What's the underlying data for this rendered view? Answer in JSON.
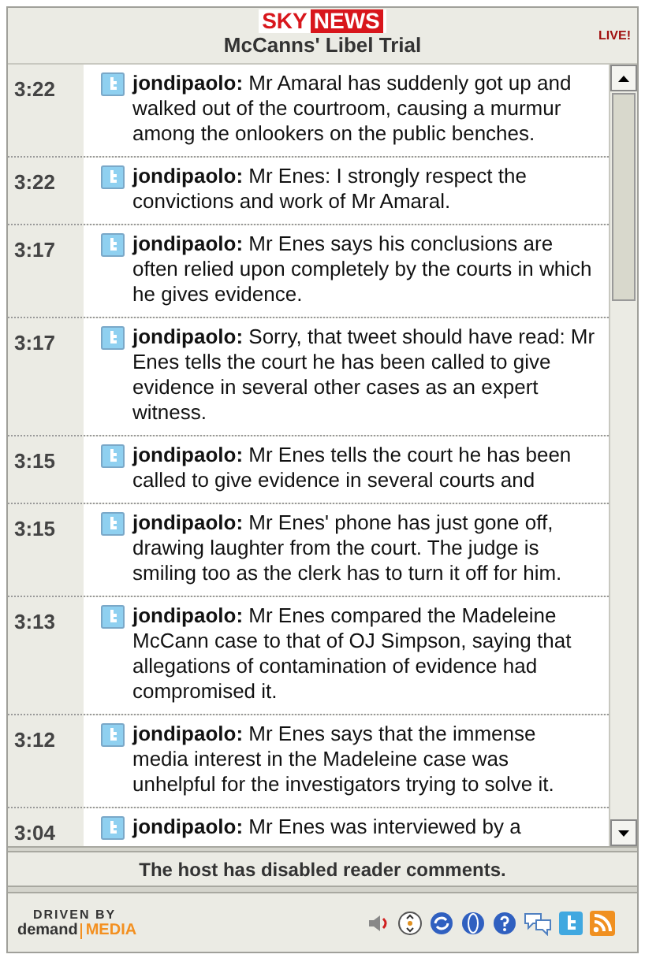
{
  "header": {
    "logo": {
      "part_1": "SKY",
      "part_2": "NEWS"
    },
    "title": "McCanns' Libel Trial",
    "badge": "LIVE!"
  },
  "messages": [
    {
      "time": "3:22",
      "text": "**jondipaolo:** Mr Amaral has suddenly got up and walked out of the courtroom, causing a murmur among the onlookers on the public benches."
    },
    {
      "time": "3:22",
      "text": "**jondipaolo:** Mr Enes: I strongly respect the convictions and work of Mr Amaral."
    },
    {
      "time": "3:17",
      "text": "**jondipaolo:** Mr Enes says his conclusions are often relied upon completely by the courts in which he gives evidence."
    },
    {
      "time": "3:17",
      "text": "**jondipaolo:** Sorry, that tweet should have read: Mr Enes tells the court he has been called to give evidence in several other cases as an expert witness."
    },
    {
      "time": "3:15",
      "text": "**jondipaolo:** Mr Enes tells the court he has been called to give evidence in several courts and"
    },
    {
      "time": "3:15",
      "text": "**jondipaolo:** Mr Enes' phone has just gone off, drawing laughter from the court. The judge is smiling too as the clerk has to turn it off for him."
    },
    {
      "time": "3:13",
      "text": "**jondipaolo:** Mr Enes compared the Madeleine McCann case to that of OJ Simpson, saying that allegations of contamination of evidence had compromised it."
    },
    {
      "time": "3:12",
      "text": "**jondipaolo:** Mr Enes says that the immense media interest in the Madeleine case was unhelpful for the investigators trying to solve it."
    },
    {
      "time": "3:04",
      "text": "**jondipaolo:** Mr Enes was interviewed by a"
    }
  ],
  "notice": "The host has disabled reader comments.",
  "footer": {
    "brand_top": "DRIVEN BY",
    "brand_left": "demand",
    "brand_right": "MEDIA"
  }
}
